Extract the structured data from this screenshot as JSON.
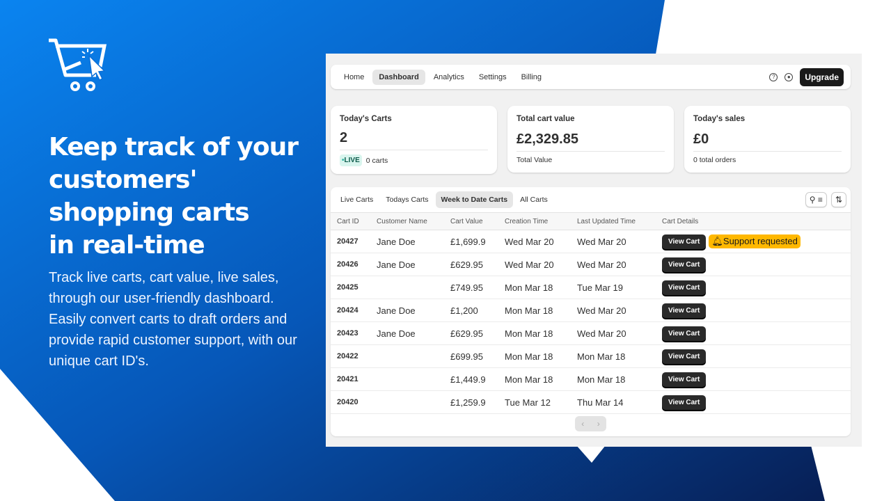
{
  "hero": {
    "headline_lines": [
      "Keep track of your",
      "customers'",
      "shopping carts",
      "in real-time"
    ],
    "body": "Track live carts, cart value, live sales, through our user-friendly dashboard. Easily convert carts to draft orders and provide rapid customer support, with our unique cart ID's."
  },
  "nav": {
    "items": [
      {
        "label": "Home"
      },
      {
        "label": "Dashboard",
        "active": true
      },
      {
        "label": "Analytics"
      },
      {
        "label": "Settings"
      },
      {
        "label": "Billing"
      }
    ],
    "help_icon": "question-circle-icon",
    "account_icon": "user-circle-icon",
    "upgrade_label": "Upgrade"
  },
  "cards": [
    {
      "title": "Today's Carts",
      "value": "2",
      "badge": "LIVE",
      "sub": "0 carts"
    },
    {
      "title": "Total cart value",
      "value": "£2,329.85",
      "sub": "Total Value"
    },
    {
      "title": "Today's sales",
      "value": "£0",
      "sub": "0 total orders"
    }
  ],
  "tabs": [
    {
      "label": "Live Carts"
    },
    {
      "label": "Todays Carts"
    },
    {
      "label": "Week to Date Carts",
      "active": true
    },
    {
      "label": "All Carts"
    }
  ],
  "columns": [
    "Cart ID",
    "Customer Name",
    "Cart Value",
    "Creation Time",
    "Last Updated Time",
    "Cart Details"
  ],
  "rows": [
    {
      "id": "20427",
      "name": "Jane Doe",
      "value": "£1,699.9",
      "created": "Wed Mar 20",
      "updated": "Wed Mar 20",
      "support": "Support requested"
    },
    {
      "id": "20426",
      "name": "Jane Doe",
      "value": "£629.95",
      "created": "Wed Mar 20",
      "updated": "Wed Mar 20"
    },
    {
      "id": "20425",
      "name": "",
      "value": "£749.95",
      "created": "Mon Mar 18",
      "updated": "Tue Mar 19"
    },
    {
      "id": "20424",
      "name": "Jane Doe",
      "value": "£1,200",
      "created": "Mon Mar 18",
      "updated": "Wed Mar 20"
    },
    {
      "id": "20423",
      "name": "Jane Doe",
      "value": "£629.95",
      "created": "Mon Mar 18",
      "updated": "Wed Mar 20"
    },
    {
      "id": "20422",
      "name": "",
      "value": "£699.95",
      "created": "Mon Mar 18",
      "updated": "Mon Mar 18"
    },
    {
      "id": "20421",
      "name": "",
      "value": "£1,449.9",
      "created": "Mon Mar 18",
      "updated": "Mon Mar 18"
    },
    {
      "id": "20420",
      "name": "",
      "value": "£1,259.9",
      "created": "Tue Mar 12",
      "updated": "Thu Mar 14"
    }
  ],
  "view_cart_label": "View Cart",
  "colors": {
    "bg_blue_light": "#0a84f0",
    "bg_blue_dark": "#0a2a6a",
    "support": "#ffb800",
    "live_dot": "#29b6a0"
  }
}
